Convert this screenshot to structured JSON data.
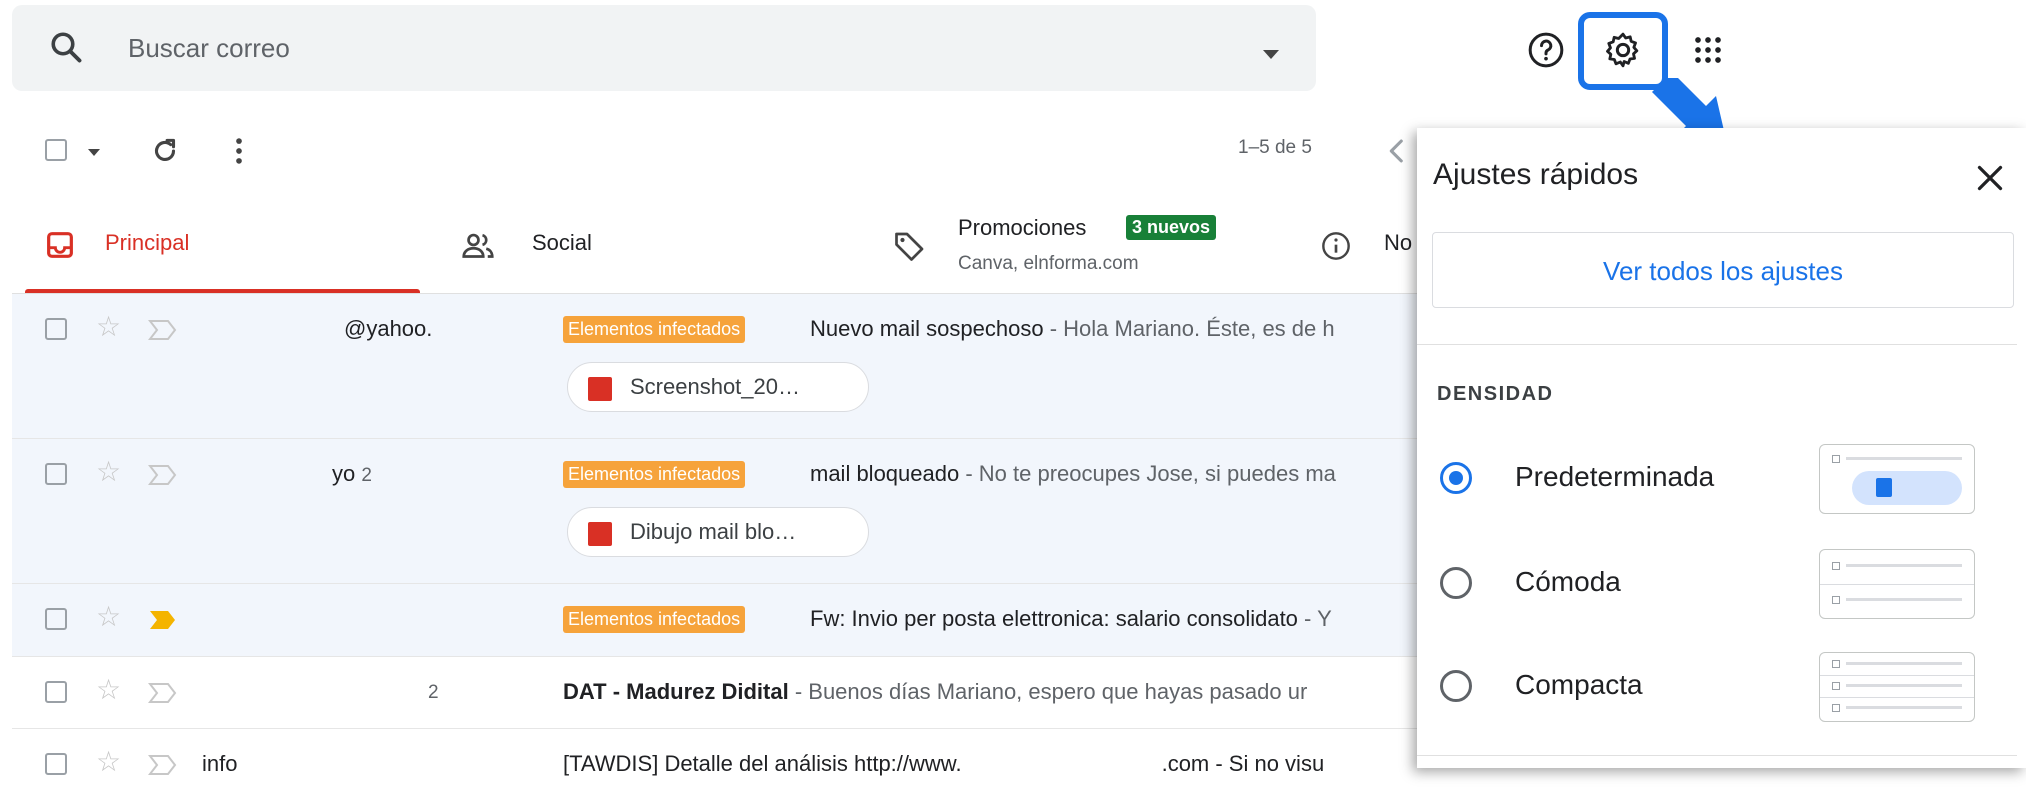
{
  "search": {
    "placeholder": "Buscar correo"
  },
  "toolbar": {
    "pager": "1–5 de 5"
  },
  "tabs": [
    {
      "label": "Principal",
      "color": "#d93025"
    },
    {
      "label": "Social"
    },
    {
      "label": "Promociones",
      "badge": "3 nuevos",
      "sub": "Canva, elnforma.com"
    },
    {
      "label": "No"
    }
  ],
  "label_tag": "Elementos infectados",
  "rows": [
    {
      "sender": "@yahoo.",
      "subject": "Nuevo mail sospechoso",
      "snippet": " - Hola Mariano. Éste, es de h",
      "attachment": "Screenshot_20…",
      "read": true
    },
    {
      "sender": "yo",
      "count": "2",
      "subject": "mail bloqueado",
      "snippet": " - No te preocupes Jose, si puedes ma",
      "attachment": "Dibujo mail blo…",
      "read": true
    },
    {
      "sender": "",
      "subject": "Fw: Invio per posta elettronica: salario consolidato",
      "snippet": " - Y",
      "read": true,
      "important": true
    },
    {
      "sender": "",
      "count": "2",
      "subject": "DAT - Madurez Didital",
      "snippet": " - Buenos días Mariano, espero que hayas pasado ur",
      "read": false,
      "bold": true
    },
    {
      "sender": "info",
      "subject": "[TAWDIS] Detalle del análisis http://www.",
      "subject_tail": ".com - Si no visu",
      "read": false
    }
  ],
  "quick_settings": {
    "title": "Ajustes rápidos",
    "all_settings_button": "Ver todos los ajustes",
    "density_heading": "DENSIDAD",
    "options": [
      {
        "label": "Predeterminada",
        "selected": true
      },
      {
        "label": "Cómoda",
        "selected": false
      },
      {
        "label": "Compacta",
        "selected": false
      }
    ]
  },
  "colors": {
    "accent": "#1a73e8",
    "label_orange": "#f6a33b",
    "badge_green": "#188038",
    "principal_red": "#d93025"
  }
}
